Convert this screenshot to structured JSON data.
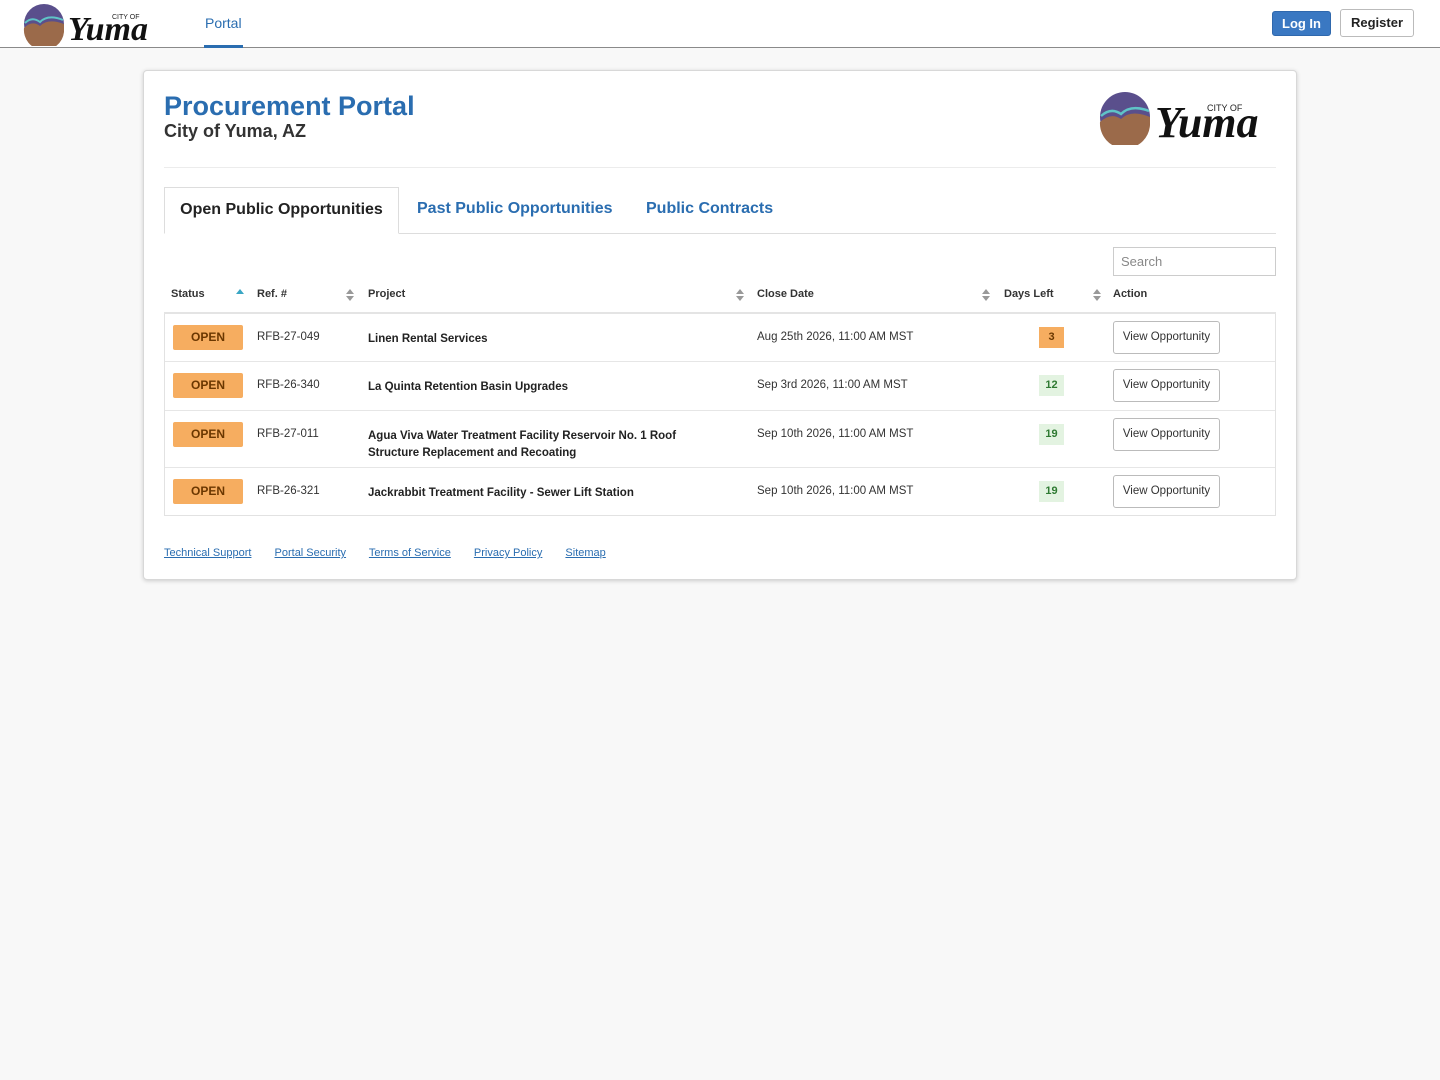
{
  "nav": {
    "logo_text": "CITY OF Yuma",
    "portal_label": "Portal",
    "login_label": "Log In",
    "register_label": "Register"
  },
  "page": {
    "title": "Procurement Portal",
    "subtitle": "City of Yuma, AZ"
  },
  "tabs": [
    {
      "label": "Open Public Opportunities",
      "active": true
    },
    {
      "label": "Past Public Opportunities",
      "active": false
    },
    {
      "label": "Public Contracts",
      "active": false
    }
  ],
  "search": {
    "placeholder": "Search"
  },
  "table": {
    "columns": [
      "Status",
      "Ref. #",
      "Project",
      "Close Date",
      "Days Left",
      "Action"
    ],
    "rows": [
      {
        "status": "OPEN",
        "ref": "RFB-27-049",
        "project": "Linen Rental Services",
        "close_date": "Aug 25th 2026, 11:00 AM MST",
        "days_left": "3",
        "days_color": "#f6ad60",
        "action": "View Opportunity"
      },
      {
        "status": "OPEN",
        "ref": "RFB-26-340",
        "project": "La Quinta Retention Basin Upgrades",
        "close_date": "Sep 3rd 2026, 11:00 AM MST",
        "days_left": "12",
        "days_color": "#e3f3e1",
        "action": "View Opportunity"
      },
      {
        "status": "OPEN",
        "ref": "RFB-27-011",
        "project": "Agua Viva Water Treatment Facility Reservoir No. 1 Roof Structure Replacement and Recoating",
        "close_date": "Sep 10th 2026, 11:00 AM MST",
        "days_left": "19",
        "days_color": "#e3f3e1",
        "action": "View Opportunity"
      },
      {
        "status": "OPEN",
        "ref": "RFB-26-321",
        "project": "Jackrabbit Treatment Facility - Sewer Lift Station",
        "close_date": "Sep 10th 2026, 11:00 AM MST",
        "days_left": "19",
        "days_color": "#e3f3e1",
        "action": "View Opportunity"
      }
    ]
  },
  "footer": {
    "links": [
      "Technical Support",
      "Portal Security",
      "Terms of Service",
      "Privacy Policy",
      "Sitemap"
    ]
  },
  "colors": {
    "accent": "#2a6db0",
    "status_open": "#f6ad60",
    "days_urgent": "#f6ad60",
    "days_ok": "#e3f3e1"
  }
}
